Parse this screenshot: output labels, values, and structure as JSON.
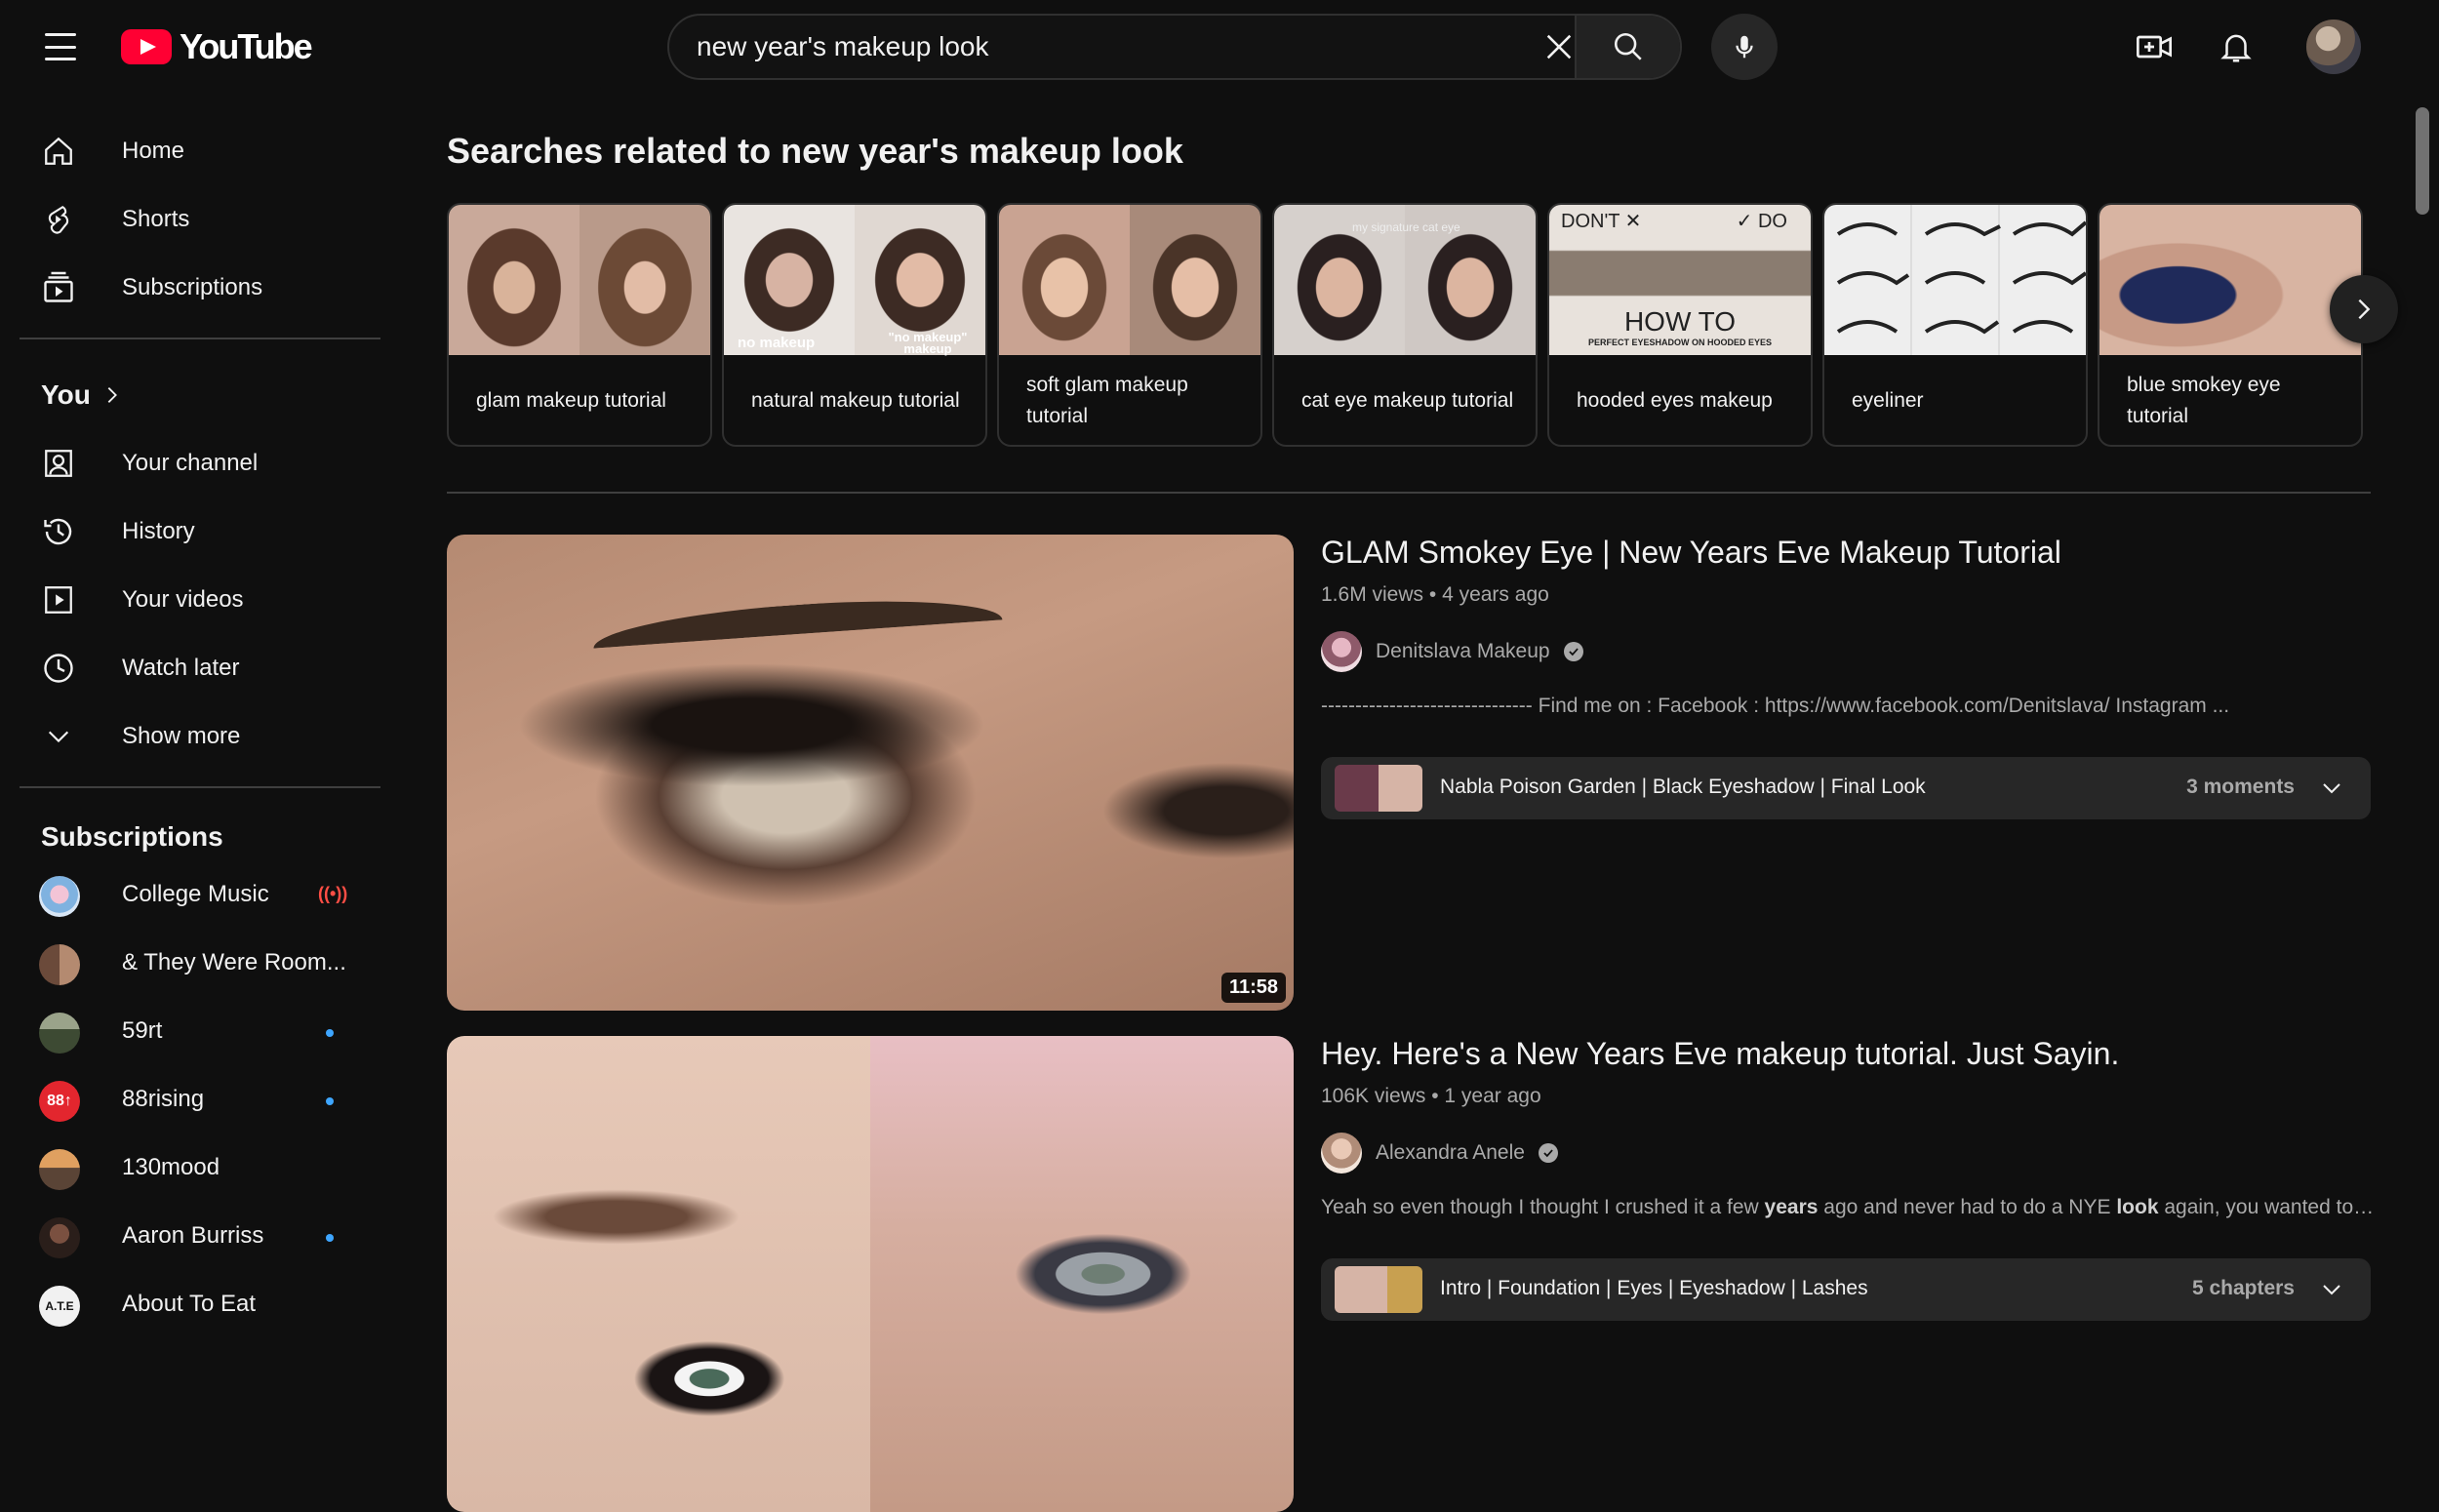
{
  "app": {
    "title": "YouTube"
  },
  "search": {
    "value": "new year's makeup look",
    "placeholder": "Search"
  },
  "sidebar": {
    "nav": [
      {
        "label": "Home",
        "icon": "home-icon"
      },
      {
        "label": "Shorts",
        "icon": "shorts-icon"
      },
      {
        "label": "Subscriptions",
        "icon": "subscriptions-icon"
      }
    ],
    "you_label": "You",
    "you_items": [
      {
        "label": "Your channel",
        "icon": "your-channel-icon"
      },
      {
        "label": "History",
        "icon": "history-icon"
      },
      {
        "label": "Your videos",
        "icon": "your-videos-icon"
      },
      {
        "label": "Watch later",
        "icon": "watch-later-icon"
      },
      {
        "label": "Show more",
        "icon": "chevron-down-icon"
      }
    ],
    "subscriptions_title": "Subscriptions",
    "subscriptions": [
      {
        "name": "College Music",
        "indicator": "live"
      },
      {
        "name": "& They Were Room...",
        "indicator": "none"
      },
      {
        "name": "59rt",
        "indicator": "new"
      },
      {
        "name": "88rising",
        "indicator": "new"
      },
      {
        "name": "130mood",
        "indicator": "none"
      },
      {
        "name": "Aaron Burriss",
        "indicator": "new"
      },
      {
        "name": "About To Eat",
        "indicator": "none"
      }
    ]
  },
  "related": {
    "title": "Searches related to new year's makeup look",
    "chips": [
      {
        "label": "glam makeup tutorial"
      },
      {
        "label": "natural makeup tutorial"
      },
      {
        "label": "soft glam makeup tutorial"
      },
      {
        "label": "cat eye makeup tutorial"
      },
      {
        "label": "hooded eyes makeup"
      },
      {
        "label": "eyeliner"
      },
      {
        "label": "blue smokey eye tutorial"
      }
    ],
    "thumb_text": {
      "natural_left": "no makeup",
      "natural_right": "\"no makeup\" makeup",
      "cat_eye": "my signature cat eye",
      "hooded_dont": "DON'T ✕",
      "hooded_do": "✓ DO",
      "hooded_howto": "HOW TO",
      "hooded_sub": "PERFECT EYESHADOW ON HOODED EYES"
    }
  },
  "videos": [
    {
      "title": "GLAM Smokey Eye | New Years Eve Makeup Tutorial",
      "views": "1.6M views",
      "age": "4 years ago",
      "channel": "Denitslava Makeup",
      "description": "------------------------------- Find me on : Facebook : https://www.facebook.com/Denitslava/ Instagram ...",
      "duration": "11:58",
      "moments_text": "Nabla Poison Garden | Black Eyeshadow | Final Look",
      "moments_count": "3 moments"
    },
    {
      "title": "Hey. Here's a New Years Eve makeup tutorial. Just Sayin.",
      "views": "106K views",
      "age": "1 year ago",
      "channel": "Alexandra Anele",
      "description_parts": [
        "Yeah so even though I thought I crushed it a few ",
        "years",
        " ago and never had to do a NYE ",
        "look",
        " again, you wanted to se..."
      ],
      "moments_text": "Intro | Foundation | Eyes | Eyeshadow | Lashes",
      "moments_count": "5 chapters"
    }
  ],
  "colors": {
    "accent_red": "#ff0033",
    "live_red": "#ff4e45",
    "new_dot": "#3ea6ff",
    "background": "#0f0f0f"
  }
}
